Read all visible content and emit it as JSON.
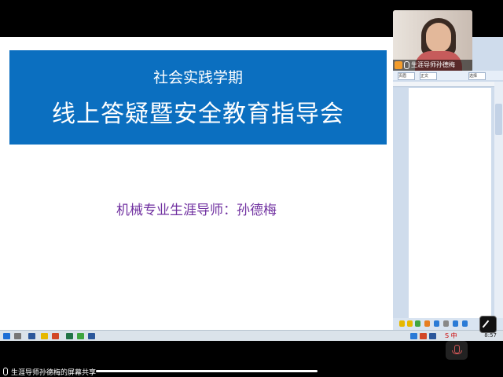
{
  "slide": {
    "title_line1": "社会实践学期",
    "title_line2": "线上答疑暨安全教育指导会",
    "presenter": "机械专业生涯导师：孙德梅",
    "banner_color": "#0b6fc0",
    "presenter_color": "#7030a0"
  },
  "video": {
    "participant_label": "生涯导师孙德梅"
  },
  "right_doc": {
    "ribbon_buttons": [
      "页眉",
      "正文",
      "选择"
    ]
  },
  "taskbar": {
    "ime": "S 中",
    "clock": "8:57"
  },
  "footer": {
    "share_label": "生涯导师孙德梅的屏幕共享"
  },
  "icons": [
    "microphone-icon",
    "user-icon",
    "mute-mic-icon",
    "view-toggle-icon",
    "windows-start-icon"
  ]
}
